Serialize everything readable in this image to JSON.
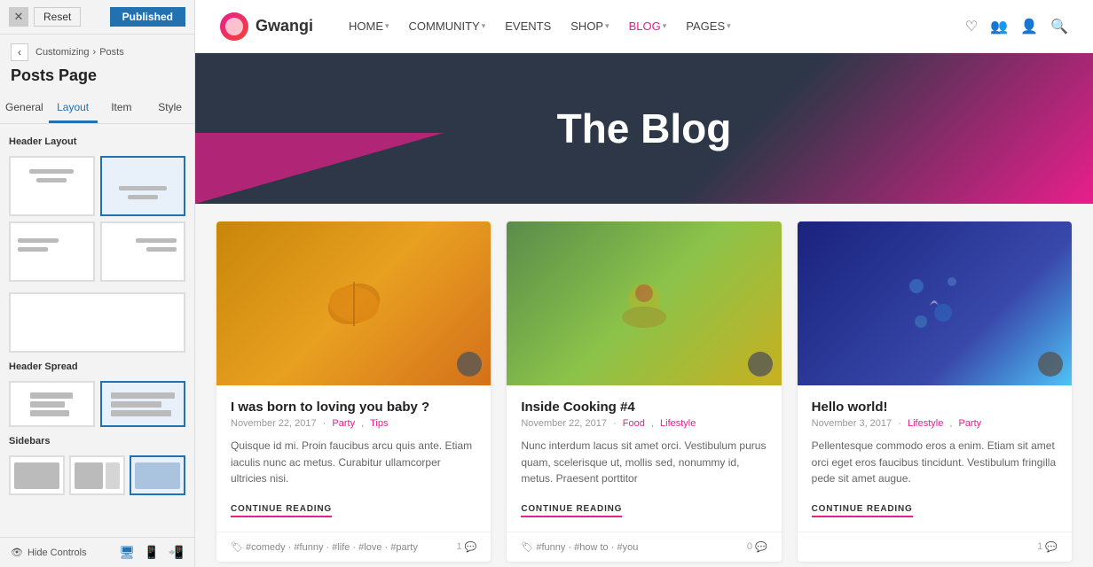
{
  "panel": {
    "close_label": "✕",
    "reset_label": "Reset",
    "published_label": "Published",
    "breadcrumb_customizing": "Customizing",
    "breadcrumb_sep": "›",
    "breadcrumb_posts": "Posts",
    "page_title": "Posts Page",
    "tabs": [
      {
        "id": "general",
        "label": "General"
      },
      {
        "id": "layout",
        "label": "Layout",
        "active": true
      },
      {
        "id": "item",
        "label": "Item"
      },
      {
        "id": "style",
        "label": "Style"
      }
    ],
    "sections": {
      "header_layout": "Header Layout",
      "header_spread": "Header Spread",
      "sidebars": "Sidebars"
    },
    "footer": {
      "hide_controls": "Hide Controls"
    }
  },
  "nav": {
    "logo_text": "Gwangi",
    "links": [
      {
        "label": "HOME",
        "has_arrow": true
      },
      {
        "label": "COMMUNITY",
        "has_arrow": true
      },
      {
        "label": "EVENTS",
        "has_arrow": false
      },
      {
        "label": "SHOP",
        "has_arrow": true
      },
      {
        "label": "BLOG",
        "has_arrow": true,
        "active": true
      },
      {
        "label": "PAGES",
        "has_arrow": true
      }
    ]
  },
  "hero": {
    "title": "The Blog"
  },
  "cards": [
    {
      "id": "card-1",
      "img_class": "img-autumn",
      "title": "I was born to loving you baby ?",
      "date": "November 22, 2017",
      "tags": [
        "Party",
        "Tips"
      ],
      "excerpt": "Quisque id mi. Proin faucibus arcu quis ante. Etiam iaculis nunc ac metus. Curabitur ullamcorper ultricies nisi.",
      "continue_label": "CONTINUE READING",
      "footer_tags": [
        "#comedy",
        "#funny",
        "#life",
        "#love",
        "#party"
      ],
      "comment_count": "1"
    },
    {
      "id": "card-2",
      "img_class": "img-food",
      "title": "Inside Cooking #4",
      "date": "November 22, 2017",
      "tags": [
        "Food",
        "Lifestyle"
      ],
      "excerpt": "Nunc interdum lacus sit amet orci. Vestibulum purus quam, scelerisque ut, mollis sed, nonummy id, metus. Praesent porttitor",
      "continue_label": "CONTINUE READING",
      "footer_tags": [
        "#funny",
        "#how to",
        "#you"
      ],
      "comment_count": "0"
    },
    {
      "id": "card-3",
      "img_class": "img-bokeh",
      "title": "Hello world!",
      "date": "November 3, 2017",
      "tags": [
        "Lifestyle",
        "Party"
      ],
      "excerpt": "Pellentesque commodo eros a enim. Etiam sit amet orci eget eros faucibus tincidunt. Vestibulum fringilla pede sit amet augue.",
      "continue_label": "CONTINUE READING",
      "footer_tags": [],
      "comment_count": "1"
    }
  ]
}
